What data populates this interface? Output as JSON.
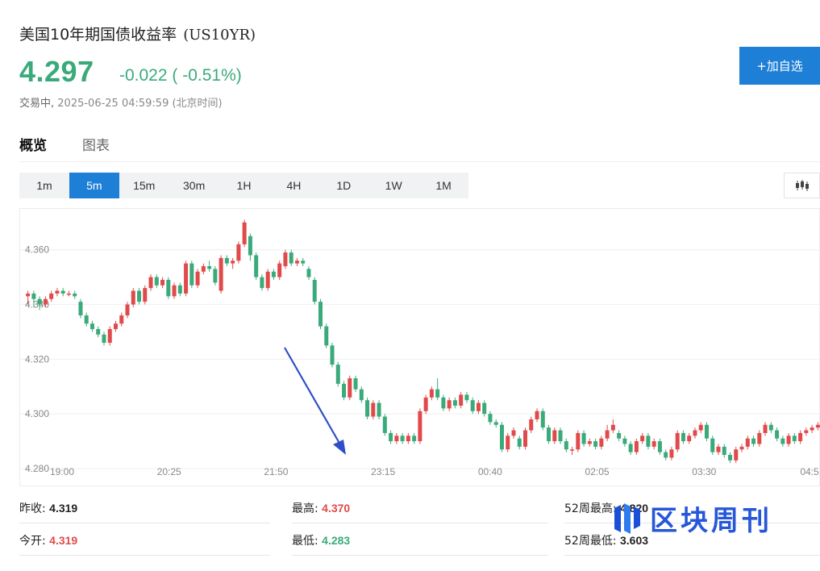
{
  "header": {
    "title": "美国10年期国债收益率",
    "symbol": "(US10YR)",
    "price": "4.297",
    "change": "-0.022 ( -0.51%)",
    "status": "交易中,",
    "timestamp": "2025-06-25 04:59:59 (北京时间)",
    "follow_button": "+加自选"
  },
  "tabs": [
    "概览",
    "图表"
  ],
  "intervals": [
    "1m",
    "5m",
    "15m",
    "30m",
    "1H",
    "4H",
    "1D",
    "1W",
    "1M"
  ],
  "active_interval": "5m",
  "stats": {
    "prev_close_label": "昨收:",
    "prev_close": "4.319",
    "open_label": "今开:",
    "open": "4.319",
    "high_label": "最高:",
    "high": "4.370",
    "low_label": "最低:",
    "low": "4.283",
    "wk52_high_label": "52周最高:",
    "wk52_high": "4.820",
    "wk52_low_label": "52周最低:",
    "wk52_low": "3.603"
  },
  "watermark": {
    "text": "区块周刊"
  },
  "colors": {
    "up": "#e04a4a",
    "down": "#3aaa7b",
    "accent": "#1e7fd6",
    "arrow": "#2f4fc9"
  },
  "chart_data": {
    "type": "candlestick",
    "ylim": [
      4.28,
      4.372
    ],
    "yticks": [
      "4.360",
      "4.340",
      "4.320",
      "4.300",
      "4.280"
    ],
    "xticks": [
      "19:00",
      "20:25",
      "21:50",
      "23:15",
      "00:40",
      "02:05",
      "03:30",
      "04:5"
    ],
    "candles": [
      [
        4.343,
        4.344,
        4.34,
        4.345
      ],
      [
        4.344,
        4.342,
        4.339,
        4.345
      ],
      [
        4.342,
        4.34,
        4.338,
        4.343
      ],
      [
        4.34,
        4.342,
        4.339,
        4.343
      ],
      [
        4.342,
        4.344,
        4.341,
        4.345
      ],
      [
        4.344,
        4.345,
        4.343,
        4.346
      ],
      [
        4.345,
        4.344,
        4.343,
        4.346
      ],
      [
        4.344,
        4.344,
        4.343,
        4.345
      ],
      [
        4.344,
        4.343,
        4.342,
        4.345
      ],
      [
        4.341,
        4.336,
        4.335,
        4.342
      ],
      [
        4.336,
        4.333,
        4.332,
        4.337
      ],
      [
        4.333,
        4.331,
        4.33,
        4.334
      ],
      [
        4.331,
        4.329,
        4.328,
        4.332
      ],
      [
        4.329,
        4.326,
        4.325,
        4.33
      ],
      [
        4.326,
        4.331,
        4.325,
        4.332
      ],
      [
        4.331,
        4.333,
        4.33,
        4.334
      ],
      [
        4.333,
        4.336,
        4.332,
        4.337
      ],
      [
        4.336,
        4.34,
        4.335,
        4.341
      ],
      [
        4.34,
        4.345,
        4.339,
        4.346
      ],
      [
        4.345,
        4.341,
        4.34,
        4.346
      ],
      [
        4.341,
        4.346,
        4.34,
        4.347
      ],
      [
        4.346,
        4.35,
        4.345,
        4.351
      ],
      [
        4.35,
        4.347,
        4.346,
        4.351
      ],
      [
        4.347,
        4.349,
        4.346,
        4.35
      ],
      [
        4.349,
        4.343,
        4.342,
        4.35
      ],
      [
        4.343,
        4.347,
        4.342,
        4.348
      ],
      [
        4.347,
        4.344,
        4.343,
        4.348
      ],
      [
        4.344,
        4.355,
        4.343,
        4.356
      ],
      [
        4.355,
        4.347,
        4.346,
        4.356
      ],
      [
        4.347,
        4.352,
        4.346,
        4.353
      ],
      [
        4.352,
        4.354,
        4.351,
        4.355
      ],
      [
        4.354,
        4.353,
        4.352,
        4.356
      ],
      [
        4.353,
        4.348,
        4.347,
        4.354
      ],
      [
        4.345,
        4.357,
        4.344,
        4.358
      ],
      [
        4.357,
        4.355,
        4.354,
        4.358
      ],
      [
        4.355,
        4.356,
        4.353,
        4.357
      ],
      [
        4.356,
        4.362,
        4.355,
        4.363
      ],
      [
        4.362,
        4.37,
        4.361,
        4.371
      ],
      [
        4.365,
        4.358,
        4.356,
        4.366
      ],
      [
        4.358,
        4.35,
        4.349,
        4.359
      ],
      [
        4.35,
        4.346,
        4.345,
        4.351
      ],
      [
        4.346,
        4.352,
        4.345,
        4.353
      ],
      [
        4.352,
        4.35,
        4.349,
        4.353
      ],
      [
        4.35,
        4.355,
        4.349,
        4.356
      ],
      [
        4.354,
        4.359,
        4.353,
        4.36
      ],
      [
        4.359,
        4.355,
        4.354,
        4.36
      ],
      [
        4.355,
        4.356,
        4.354,
        4.357
      ],
      [
        4.356,
        4.355,
        4.354,
        4.357
      ],
      [
        4.353,
        4.35,
        4.349,
        4.354
      ],
      [
        4.349,
        4.341,
        4.34,
        4.35
      ],
      [
        4.341,
        4.332,
        4.331,
        4.342
      ],
      [
        4.332,
        4.325,
        4.324,
        4.333
      ],
      [
        4.325,
        4.318,
        4.317,
        4.326
      ],
      [
        4.318,
        4.311,
        4.31,
        4.319
      ],
      [
        4.311,
        4.306,
        4.305,
        4.312
      ],
      [
        4.306,
        4.313,
        4.305,
        4.314
      ],
      [
        4.313,
        4.309,
        4.308,
        4.314
      ],
      [
        4.309,
        4.305,
        4.304,
        4.31
      ],
      [
        4.305,
        4.299,
        4.298,
        4.306
      ],
      [
        4.299,
        4.304,
        4.298,
        4.305
      ],
      [
        4.304,
        4.299,
        4.298,
        4.305
      ],
      [
        4.299,
        4.293,
        4.292,
        4.3
      ],
      [
        4.293,
        4.29,
        4.289,
        4.294
      ],
      [
        4.29,
        4.292,
        4.289,
        4.293
      ],
      [
        4.292,
        4.29,
        4.289,
        4.293
      ],
      [
        4.29,
        4.292,
        4.289,
        4.293
      ],
      [
        4.292,
        4.29,
        4.289,
        4.293
      ],
      [
        4.29,
        4.301,
        4.289,
        4.302
      ],
      [
        4.301,
        4.306,
        4.3,
        4.307
      ],
      [
        4.306,
        4.309,
        4.305,
        4.31
      ],
      [
        4.309,
        4.306,
        4.305,
        4.313
      ],
      [
        4.306,
        4.302,
        4.301,
        4.307
      ],
      [
        4.302,
        4.305,
        4.301,
        4.306
      ],
      [
        4.305,
        4.303,
        4.302,
        4.306
      ],
      [
        4.303,
        4.307,
        4.302,
        4.308
      ],
      [
        4.307,
        4.305,
        4.304,
        4.308
      ],
      [
        4.305,
        4.301,
        4.3,
        4.306
      ],
      [
        4.301,
        4.304,
        4.3,
        4.305
      ],
      [
        4.304,
        4.3,
        4.299,
        4.305
      ],
      [
        4.3,
        4.297,
        4.296,
        4.301
      ],
      [
        4.297,
        4.296,
        4.295,
        4.298
      ],
      [
        4.296,
        4.287,
        4.286,
        4.297
      ],
      [
        4.287,
        4.292,
        4.286,
        4.293
      ],
      [
        4.292,
        4.294,
        4.291,
        4.295
      ],
      [
        4.291,
        4.288,
        4.287,
        4.292
      ],
      [
        4.288,
        4.294,
        4.287,
        4.295
      ],
      [
        4.294,
        4.298,
        4.293,
        4.299
      ],
      [
        4.298,
        4.301,
        4.297,
        4.302
      ],
      [
        4.301,
        4.295,
        4.294,
        4.302
      ],
      [
        4.295,
        4.29,
        4.289,
        4.296
      ],
      [
        4.29,
        4.294,
        4.289,
        4.295
      ],
      [
        4.294,
        4.29,
        4.289,
        4.295
      ],
      [
        4.29,
        4.287,
        4.286,
        4.291
      ],
      [
        4.287,
        4.287,
        4.285,
        4.288
      ],
      [
        4.287,
        4.293,
        4.286,
        4.294
      ],
      [
        4.293,
        4.289,
        4.288,
        4.294
      ],
      [
        4.289,
        4.29,
        4.288,
        4.291
      ],
      [
        4.29,
        4.288,
        4.287,
        4.291
      ],
      [
        4.288,
        4.291,
        4.287,
        4.292
      ],
      [
        4.291,
        4.294,
        4.29,
        4.296
      ],
      [
        4.294,
        4.296,
        4.293,
        4.298
      ],
      [
        4.293,
        4.291,
        4.29,
        4.294
      ],
      [
        4.291,
        4.289,
        4.288,
        4.292
      ],
      [
        4.289,
        4.286,
        4.285,
        4.29
      ],
      [
        4.286,
        4.29,
        4.285,
        4.291
      ],
      [
        4.29,
        4.292,
        4.289,
        4.293
      ],
      [
        4.292,
        4.288,
        4.287,
        4.293
      ],
      [
        4.288,
        4.29,
        4.287,
        4.291
      ],
      [
        4.29,
        4.286,
        4.285,
        4.291
      ],
      [
        4.286,
        4.284,
        4.283,
        4.287
      ],
      [
        4.284,
        4.287,
        4.283,
        4.288
      ],
      [
        4.287,
        4.293,
        4.286,
        4.294
      ],
      [
        4.293,
        4.29,
        4.289,
        4.294
      ],
      [
        4.29,
        4.292,
        4.289,
        4.293
      ],
      [
        4.292,
        4.294,
        4.291,
        4.295
      ],
      [
        4.294,
        4.296,
        4.293,
        4.297
      ],
      [
        4.296,
        4.291,
        4.29,
        4.297
      ],
      [
        4.291,
        4.286,
        4.285,
        4.292
      ],
      [
        4.286,
        4.288,
        4.285,
        4.289
      ],
      [
        4.288,
        4.285,
        4.284,
        4.289
      ],
      [
        4.285,
        4.283,
        4.282,
        4.286
      ],
      [
        4.283,
        4.287,
        4.282,
        4.288
      ],
      [
        4.287,
        4.288,
        4.286,
        4.289
      ],
      [
        4.288,
        4.291,
        4.287,
        4.292
      ],
      [
        4.291,
        4.289,
        4.288,
        4.292
      ],
      [
        4.289,
        4.293,
        4.288,
        4.294
      ],
      [
        4.293,
        4.296,
        4.292,
        4.297
      ],
      [
        4.296,
        4.294,
        4.293,
        4.297
      ],
      [
        4.294,
        4.291,
        4.29,
        4.295
      ],
      [
        4.291,
        4.289,
        4.288,
        4.292
      ],
      [
        4.289,
        4.292,
        4.288,
        4.293
      ],
      [
        4.292,
        4.29,
        4.289,
        4.293
      ],
      [
        4.29,
        4.293,
        4.289,
        4.294
      ],
      [
        4.293,
        4.294,
        4.292,
        4.295
      ],
      [
        4.294,
        4.295,
        4.293,
        4.296
      ],
      [
        4.295,
        4.296,
        4.294,
        4.297
      ]
    ]
  }
}
